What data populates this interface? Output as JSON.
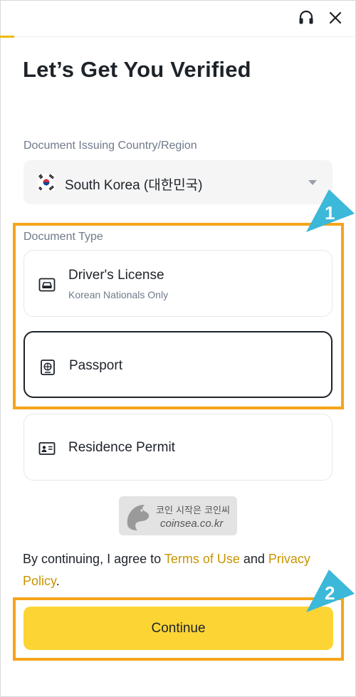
{
  "header": {
    "support_icon": "headset-icon",
    "close_icon": "close-icon",
    "progress_fraction": 0.04
  },
  "page": {
    "title": "Let’s Get You Verified"
  },
  "country": {
    "label": "Document Issuing Country/Region",
    "value": "South Korea (대한민국)",
    "flag_icon": "south-korea-flag-icon"
  },
  "document_type": {
    "label": "Document Type",
    "options": [
      {
        "name": "Driver's License",
        "sub": "Korean Nationals Only",
        "icon": "car-icon",
        "selected": false
      },
      {
        "name": "Passport",
        "icon": "passport-icon",
        "selected": true
      },
      {
        "name": "Residence Permit",
        "icon": "id-card-icon",
        "selected": false
      }
    ]
  },
  "annotations": {
    "callout_1": "1",
    "callout_2": "2",
    "highlight_color": "#f5a41a",
    "callout_color": "#3cb8d9"
  },
  "watermark": {
    "line1": "코인 시작은 코인씨",
    "line2": "coinsea.co.kr"
  },
  "consent": {
    "prefix": "By continuing, I agree to ",
    "terms_link": "Terms of Use",
    "middle": " and ",
    "privacy_link": "Privacy Policy",
    "suffix": "."
  },
  "continue_button": {
    "label": "Continue"
  },
  "colors": {
    "accent": "#fcd535",
    "link": "#c99400",
    "text": "#1e2329",
    "muted": "#707a8a"
  }
}
